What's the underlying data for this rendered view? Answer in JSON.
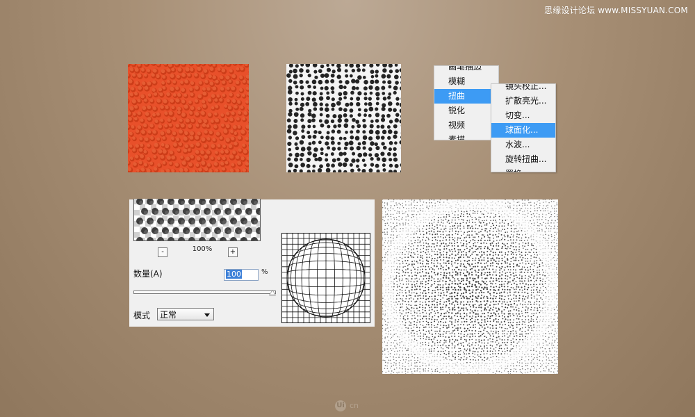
{
  "watermark": "思缘设计论坛 www.MISSYUAN.COM",
  "filter_menu": {
    "items": [
      {
        "label": "画笔描边",
        "selected": false
      },
      {
        "label": "模糊",
        "selected": false
      },
      {
        "label": "扭曲",
        "selected": true
      },
      {
        "label": "锐化",
        "selected": false
      },
      {
        "label": "视频",
        "selected": false
      },
      {
        "label": "素描",
        "selected": false
      }
    ]
  },
  "distort_menu": {
    "items": [
      {
        "label": "镜头校正...",
        "selected": false
      },
      {
        "label": "扩散亮光...",
        "selected": false
      },
      {
        "label": "切变...",
        "selected": false
      },
      {
        "label": "球面化...",
        "selected": true
      },
      {
        "label": "水波...",
        "selected": false
      },
      {
        "label": "旋转扭曲...",
        "selected": false
      },
      {
        "label": "置换",
        "selected": false
      }
    ]
  },
  "dialog": {
    "zoom_out": "-",
    "zoom_level": "100%",
    "zoom_in": "+",
    "amount_label": "数量(A)",
    "amount_value": "100",
    "amount_unit": "%",
    "amount_fraction": 1.0,
    "mode_label": "模式",
    "mode_value": "正常"
  },
  "colors": {
    "orange": "#e8502a",
    "menu_selection": "#3d9bf4"
  },
  "logo": {
    "mark": "Ui",
    "text": "cn"
  }
}
